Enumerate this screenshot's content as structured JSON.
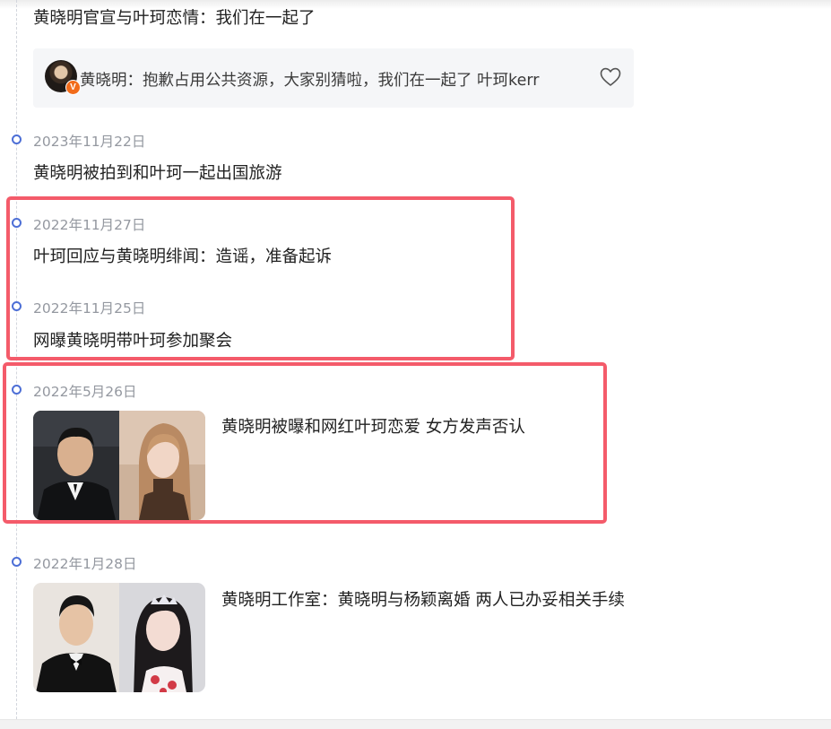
{
  "timeline": {
    "top_headline": "黄晓明官宣与叶珂恋情：我们在一起了",
    "post": {
      "text": "黄晓明：抱歉占用公共资源，大家别猜啦，我们在一起了 叶珂kerr",
      "badge": "V"
    },
    "events": [
      {
        "date": "2023年11月22日",
        "headline": "黄晓明被拍到和叶珂一起出国旅游"
      },
      {
        "date": "2022年11月27日",
        "headline": "叶珂回应与黄晓明绯闻：造谣，准备起诉"
      },
      {
        "date": "2022年11月25日",
        "headline": "网曝黄晓明带叶珂参加聚会"
      },
      {
        "date": "2022年5月26日",
        "headline": "黄晓明被曝和网红叶珂恋爱 女方发声否认"
      },
      {
        "date": "2022年1月28日",
        "headline": "黄晓明工作室：黄晓明与杨颖离婚 两人已办妥相关手续"
      }
    ]
  },
  "colors": {
    "timeline_dot": "#4d6fd6",
    "highlight_border": "#f45b6a",
    "verify_badge": "#f26c1b"
  }
}
